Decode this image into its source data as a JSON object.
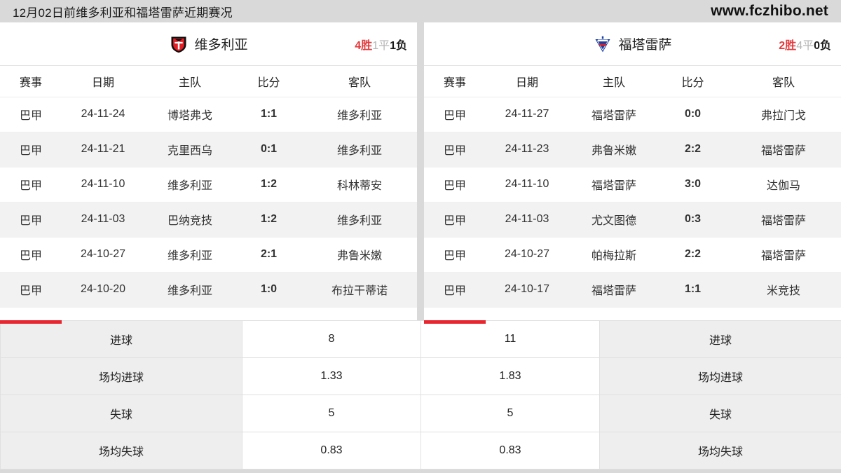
{
  "topbar": {
    "title": "12月02日前维多利亚和福塔雷萨近期赛况",
    "url": "www.fczhibo.net"
  },
  "colors": {
    "accent_red": "#e8262f",
    "accent_red_light": "#f8404c",
    "win_red": "#e4393c",
    "draw_gray": "#b5b5b5",
    "page_bg": "#d9d9d9",
    "row_alt": "#f2f2f2",
    "stat_label_bg": "#eeeeee"
  },
  "left": {
    "team": {
      "name": "维多利亚",
      "logo_icon": "vitoria-crest-icon"
    },
    "record": {
      "wins": "4胜",
      "draws": "1平",
      "losses": "1负"
    },
    "columns": [
      "赛事",
      "日期",
      "主队",
      "比分",
      "客队"
    ],
    "rows": [
      {
        "comp": "巴甲",
        "date": "24-11-24",
        "home": "博塔弗戈",
        "score": "1:1",
        "away": "维多利亚"
      },
      {
        "comp": "巴甲",
        "date": "24-11-21",
        "home": "克里西乌",
        "score": "0:1",
        "away": "维多利亚"
      },
      {
        "comp": "巴甲",
        "date": "24-11-10",
        "home": "维多利亚",
        "score": "1:2",
        "away": "科林蒂安"
      },
      {
        "comp": "巴甲",
        "date": "24-11-03",
        "home": "巴纳竞技",
        "score": "1:2",
        "away": "维多利亚"
      },
      {
        "comp": "巴甲",
        "date": "24-10-27",
        "home": "维多利亚",
        "score": "2:1",
        "away": "弗鲁米嫩"
      },
      {
        "comp": "巴甲",
        "date": "24-10-20",
        "home": "维多利亚",
        "score": "1:0",
        "away": "布拉干蒂诺"
      }
    ]
  },
  "right": {
    "team": {
      "name": "福塔雷萨",
      "logo_icon": "fortaleza-crest-icon"
    },
    "record": {
      "wins": "2胜",
      "draws": "4平",
      "losses": "0负"
    },
    "columns": [
      "赛事",
      "日期",
      "主队",
      "比分",
      "客队"
    ],
    "rows": [
      {
        "comp": "巴甲",
        "date": "24-11-27",
        "home": "福塔雷萨",
        "score": "0:0",
        "away": "弗拉门戈"
      },
      {
        "comp": "巴甲",
        "date": "24-11-23",
        "home": "弗鲁米嫩",
        "score": "2:2",
        "away": "福塔雷萨"
      },
      {
        "comp": "巴甲",
        "date": "24-11-10",
        "home": "福塔雷萨",
        "score": "3:0",
        "away": "达伽马"
      },
      {
        "comp": "巴甲",
        "date": "24-11-03",
        "home": "尤文图德",
        "score": "0:3",
        "away": "福塔雷萨"
      },
      {
        "comp": "巴甲",
        "date": "24-10-27",
        "home": "帕梅拉斯",
        "score": "2:2",
        "away": "福塔雷萨"
      },
      {
        "comp": "巴甲",
        "date": "24-10-17",
        "home": "福塔雷萨",
        "score": "1:1",
        "away": "米竞技"
      }
    ]
  },
  "stats": {
    "rows": [
      {
        "left_label": "进球",
        "left_value": "8",
        "right_value": "11",
        "right_label": "进球"
      },
      {
        "left_label": "场均进球",
        "left_value": "1.33",
        "right_value": "1.83",
        "right_label": "场均进球"
      },
      {
        "left_label": "失球",
        "left_value": "5",
        "right_value": "5",
        "right_label": "失球"
      },
      {
        "left_label": "场均失球",
        "left_value": "0.83",
        "right_value": "0.83",
        "right_label": "场均失球"
      }
    ]
  }
}
